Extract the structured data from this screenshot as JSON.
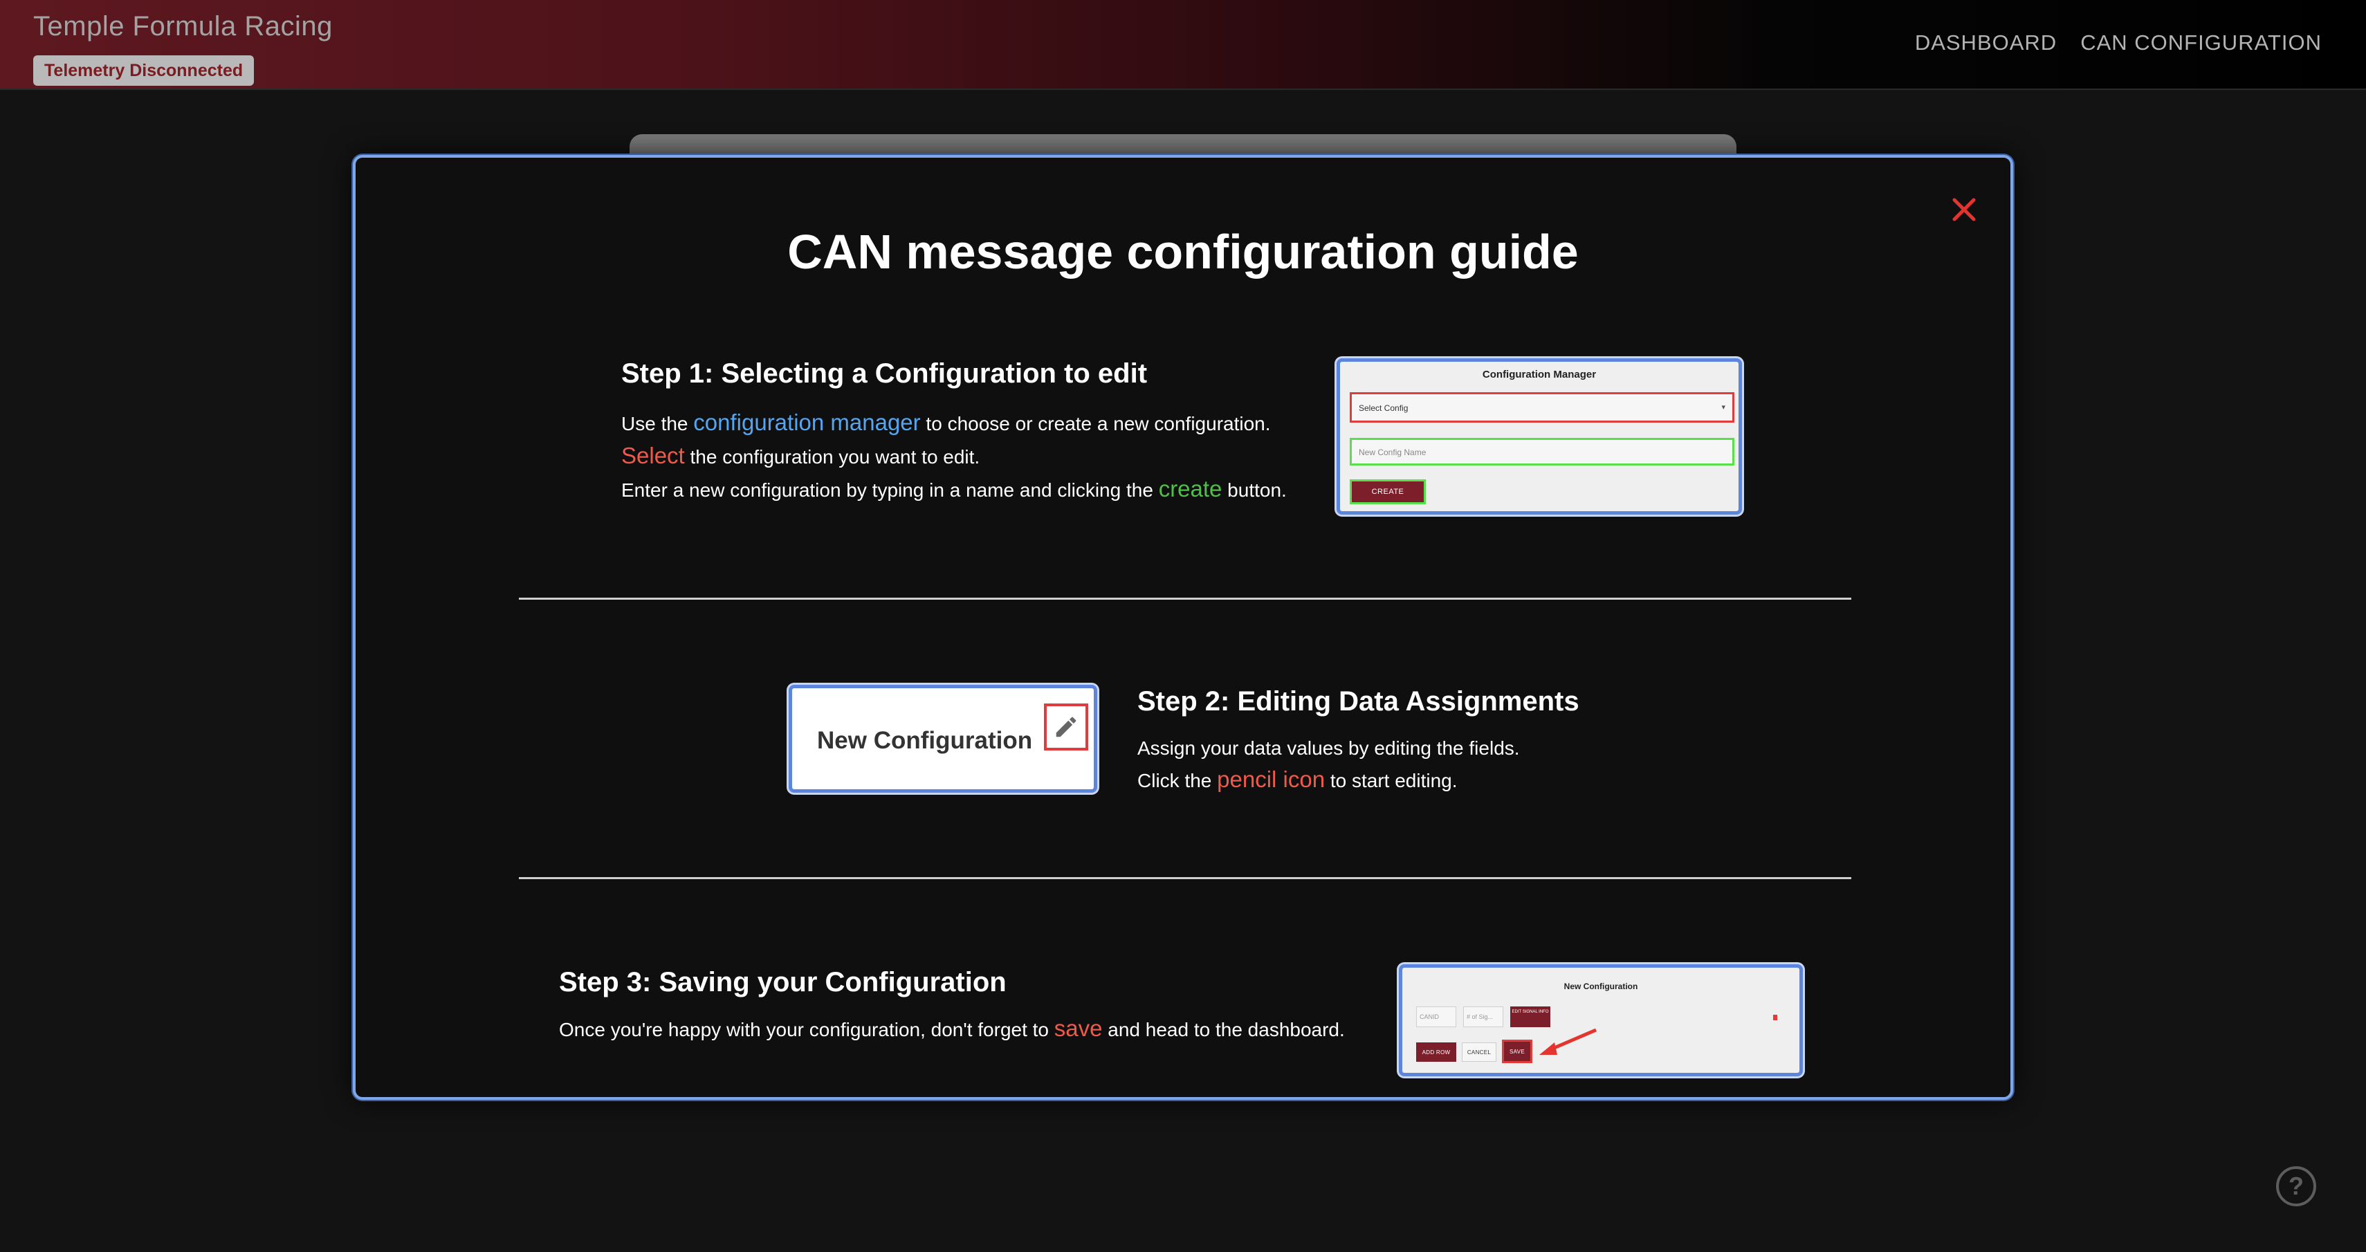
{
  "app": {
    "title": "Temple Formula Racing",
    "telemetry_status": "Telemetry Disconnected"
  },
  "nav": {
    "items": [
      "DASHBOARD",
      "CAN CONFIGURATION"
    ]
  },
  "modal": {
    "title": "CAN message configuration guide",
    "close_icon": "close-icon",
    "step1": {
      "heading": "Step 1: Selecting a Configuration to edit",
      "line1": {
        "pre": "Use the ",
        "highlight": "configuration manager",
        "post": " to choose or create a new configuration."
      },
      "line2": {
        "highlight": "Select",
        "post": " the configuration you want to edit."
      },
      "line3": {
        "pre": "Enter a new configuration by typing in a name and clicking the ",
        "highlight": "create",
        "post": " button."
      },
      "preview": {
        "title": "Configuration Manager",
        "select_placeholder": "Select Config",
        "input_placeholder": "New Config Name",
        "create_label": "CREATE"
      }
    },
    "step2": {
      "heading": "Step 2: Editing Data Assignments",
      "line1": "Assign your data values by editing the fields.",
      "line2": {
        "pre": "Click the ",
        "highlight": "pencil icon",
        "post": " to start editing."
      },
      "preview": {
        "title": "New Configuration",
        "icon": "pencil-icon"
      }
    },
    "step3": {
      "heading": "Step 3: Saving your Configuration",
      "line1": {
        "pre": "Once you're happy with your configuration, don't forget to ",
        "highlight": "save",
        "post": " and head to the dashboard."
      },
      "preview": {
        "title": "New Configuration",
        "field1": "CANID",
        "field2": "# of Sig...",
        "signal_button": "EDIT SIGNAL INFO",
        "add_row": "ADD ROW",
        "cancel": "CANCEL",
        "save": "SAVE"
      }
    }
  },
  "help": {
    "icon": "help-icon",
    "glyph": "?"
  },
  "colors": {
    "accent_blue": "#55a5f0",
    "accent_red": "#ef5a4a",
    "accent_green": "#4fbf4a",
    "brand_maroon": "#7c1f2b"
  }
}
